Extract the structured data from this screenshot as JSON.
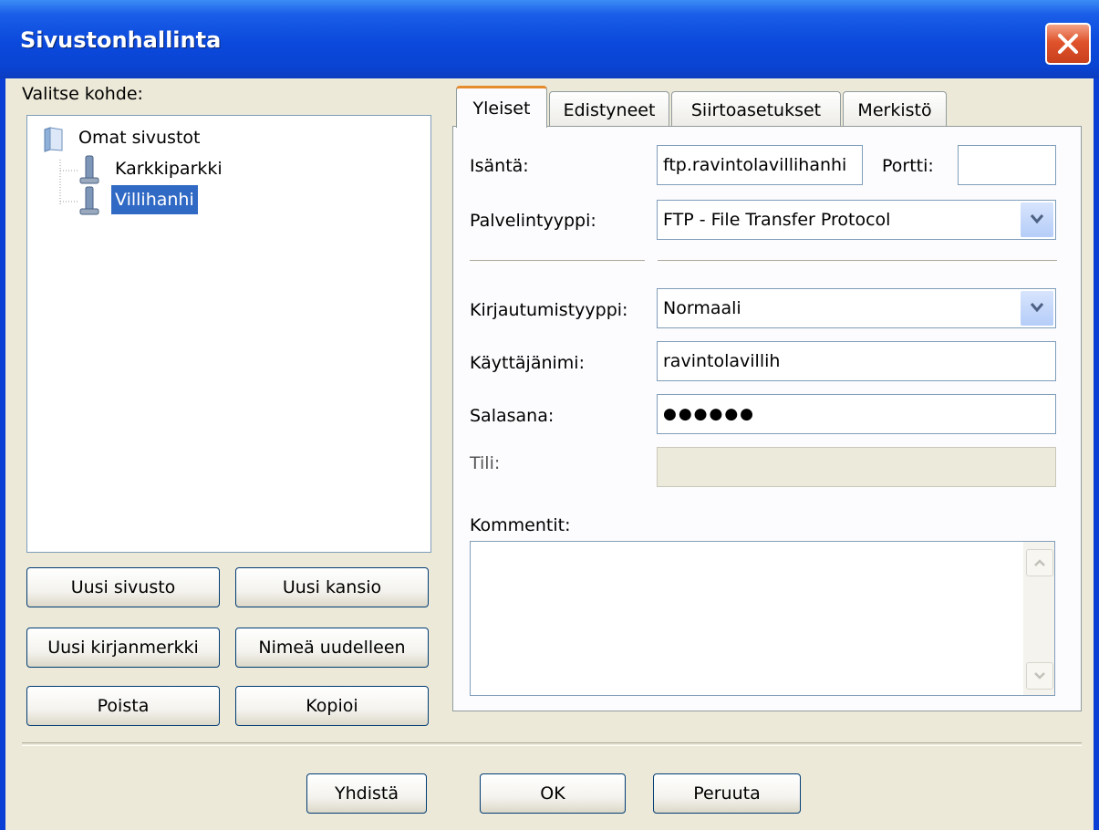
{
  "window": {
    "title": "Sivustonhallinta"
  },
  "left": {
    "label": "Valitse kohde:",
    "tree": {
      "root": "Omat sivustot",
      "items": [
        "Karkkiparkki",
        "Villihanhi"
      ]
    },
    "buttons": {
      "new_site": "Uusi sivusto",
      "new_folder": "Uusi kansio",
      "new_bookmark": "Uusi kirjanmerkki",
      "rename": "Nimeä uudelleen",
      "delete": "Poista",
      "copy": "Kopioi"
    }
  },
  "tabs": [
    "Yleiset",
    "Edistyneet",
    "Siirtoasetukset",
    "Merkistö"
  ],
  "general": {
    "host_label": "Isäntä:",
    "host_value": "ftp.ravintolavillihanhi",
    "port_label": "Portti:",
    "port_value": "",
    "server_type_label": "Palvelintyyppi:",
    "server_type_value": "FTP - File Transfer Protocol",
    "logon_type_label": "Kirjautumistyyppi:",
    "logon_type_value": "Normaali",
    "user_label": "Käyttäjänimi:",
    "user_value": "ravintolavillih",
    "password_label": "Salasana:",
    "password_value": "●●●●●●",
    "account_label": "Tili:",
    "account_value": "",
    "comments_label": "Kommentit:"
  },
  "bottom": {
    "connect": "Yhdistä",
    "ok": "OK",
    "cancel": "Peruuta"
  },
  "colors": {
    "title_bar": "#0a44d2",
    "selection": "#316ac5",
    "active_tab_accent": "#e68b2c"
  }
}
